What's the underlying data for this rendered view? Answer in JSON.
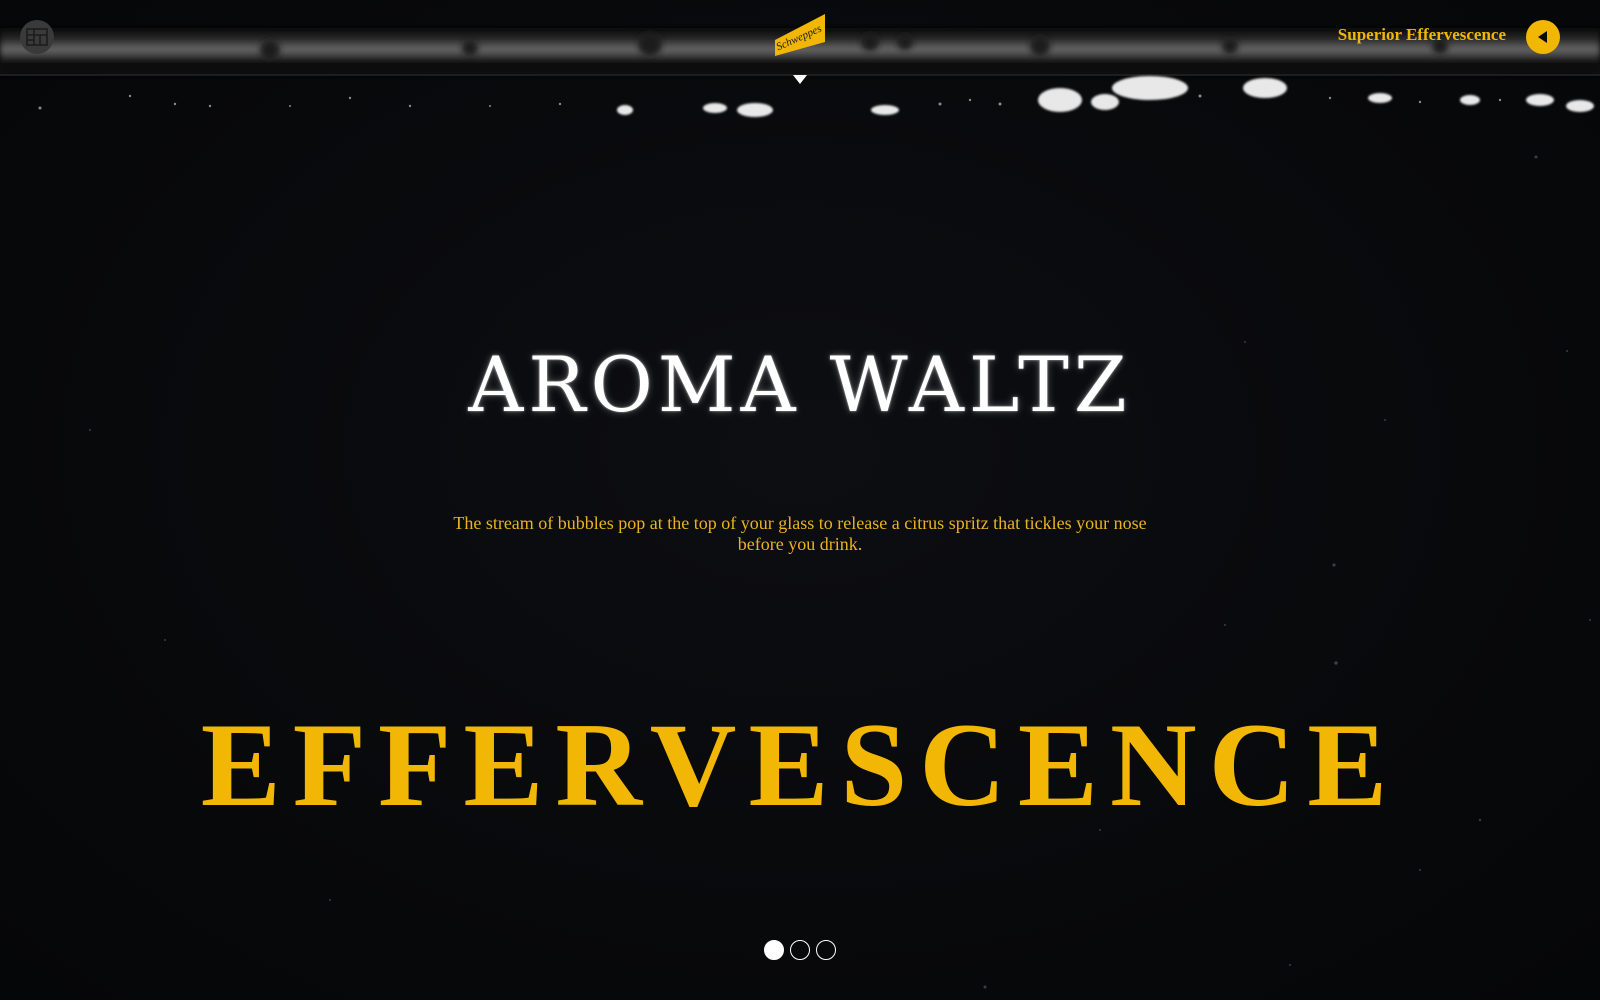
{
  "header": {
    "menu_icon": "grid-menu-icon",
    "logo_text": "Schweppes",
    "scroll_icon": "caret-down-icon",
    "nav_title": "Superior Effervescence",
    "back_icon": "play-left-icon"
  },
  "hero": {
    "headline": "AROMA WALTZ",
    "description": "The stream of bubbles pop at the top of your glass to release a citrus spritz that tickles your nose before you drink.",
    "big_word": "EFFERVESCENCE"
  },
  "pagination": {
    "total": 3,
    "active_index": 0
  },
  "colors": {
    "accent": "#f2b705",
    "background": "#08090b",
    "headline": "#ffffff"
  }
}
